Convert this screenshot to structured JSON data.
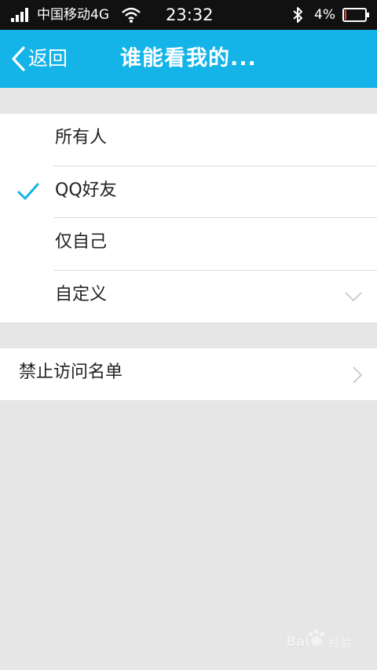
{
  "status_bar": {
    "carrier": "中国移动4G",
    "time": "23:32",
    "battery_percent": "4%",
    "icons": [
      "signal-icon",
      "wifi-icon",
      "bluetooth-icon",
      "battery-icon"
    ]
  },
  "nav": {
    "back_label": "返回",
    "title": "谁能看我的..."
  },
  "options": {
    "items": [
      {
        "label": "所有人",
        "selected": false
      },
      {
        "label": "QQ好友",
        "selected": true
      },
      {
        "label": "仅自己",
        "selected": false
      },
      {
        "label": "自定义",
        "selected": false,
        "expandable": true
      }
    ]
  },
  "blocklist": {
    "label": "禁止访问名单"
  },
  "watermark": {
    "text_left": "Bai",
    "text_right": "经验"
  },
  "colors": {
    "nav_bg": "#14b3e8",
    "check": "#14b3e8",
    "page_bg": "#e6e6e6"
  }
}
